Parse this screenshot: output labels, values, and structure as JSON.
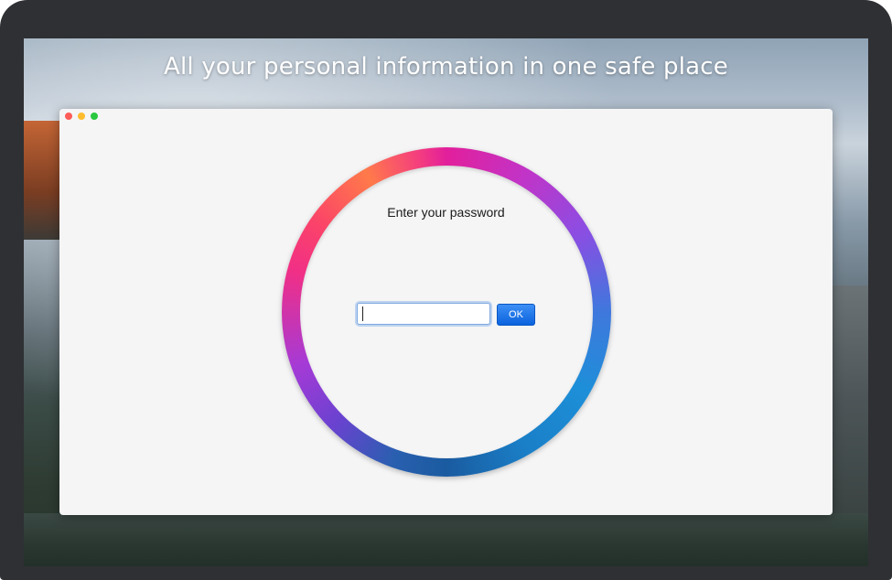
{
  "banner": {
    "headline": "All your personal information in one safe place"
  },
  "window": {
    "traffic_lights": {
      "close": "#fc5c57",
      "minimize": "#fdbc2f",
      "maximize": "#29c840"
    }
  },
  "login": {
    "prompt": "Enter your password",
    "password_value": "",
    "ok_label": "OK"
  },
  "colors": {
    "accent": "#0b63dd",
    "window_bg": "#f5f5f6"
  }
}
